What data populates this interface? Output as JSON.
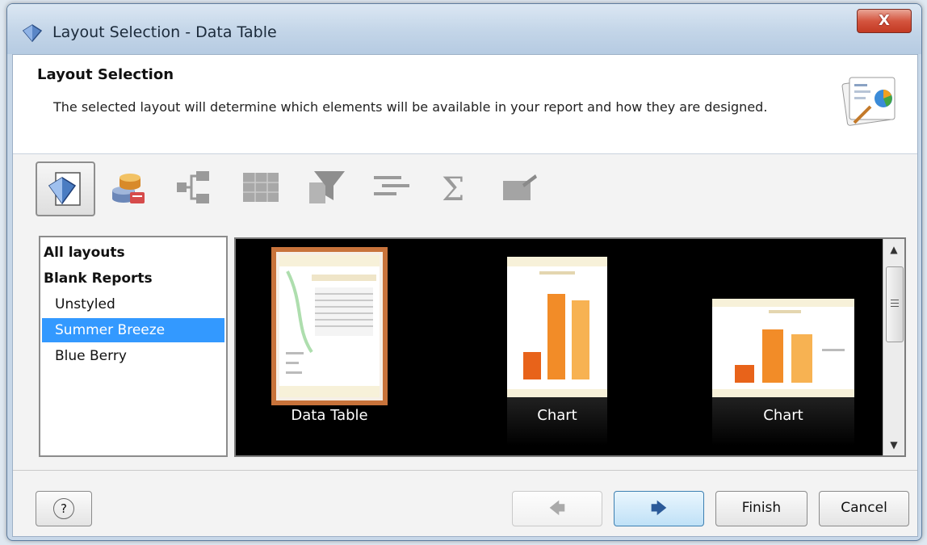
{
  "window": {
    "title": "Layout Selection - Data Table",
    "close_label": "X"
  },
  "header": {
    "title": "Layout Selection",
    "description": "The selected layout will determine which elements will be available in your report and how they are designed."
  },
  "toolbar": {
    "steps": [
      {
        "icon": "layout-diamond-icon",
        "active": true
      },
      {
        "icon": "database-stack-icon",
        "active": false
      },
      {
        "icon": "hierarchy-icon",
        "active": false
      },
      {
        "icon": "table-grid-icon",
        "active": false
      },
      {
        "icon": "filter-funnel-icon",
        "active": false
      },
      {
        "icon": "align-lines-icon",
        "active": false
      },
      {
        "icon": "sigma-icon",
        "active": false
      },
      {
        "icon": "edit-box-icon",
        "active": false
      }
    ]
  },
  "layouts": {
    "items": [
      {
        "label": "All layouts",
        "bold": true
      },
      {
        "label": "Blank Reports",
        "bold": true
      },
      {
        "label": "Unstyled",
        "bold": false
      },
      {
        "label": "Summer Breeze",
        "bold": false,
        "selected": true
      },
      {
        "label": "Blue Berry",
        "bold": false
      }
    ]
  },
  "thumbnails": [
    {
      "caption": "Data Table",
      "selected": true
    },
    {
      "caption": "Chart",
      "selected": false
    },
    {
      "caption": "Chart",
      "selected": false
    }
  ],
  "footer": {
    "help_label": "?",
    "back_label": "🡄",
    "next_label": "🡆",
    "finish_label": "Finish",
    "cancel_label": "Cancel"
  },
  "colors": {
    "selection": "#3399ff",
    "thumb_border": "#c8733b",
    "bar_orange": "#f28c28",
    "bar_dark_orange": "#e8631a"
  }
}
